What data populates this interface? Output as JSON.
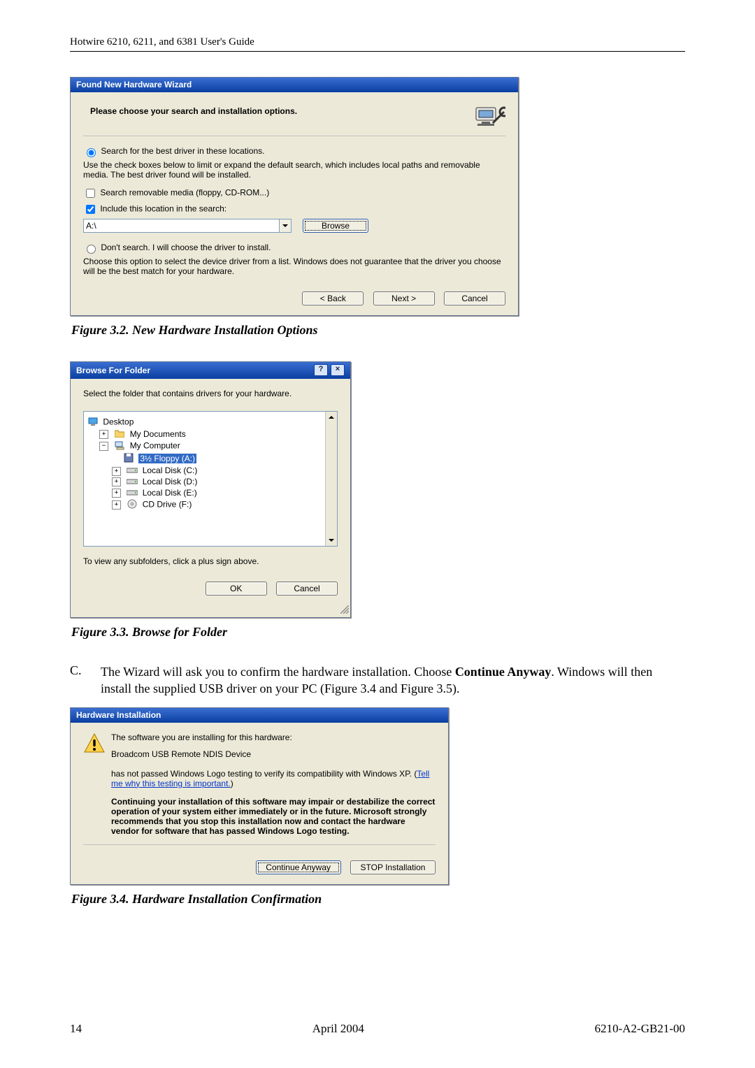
{
  "page": {
    "running_head": "Hotwire 6210, 6211, and 6381 User's Guide",
    "page_number": "14",
    "date": "April 2004",
    "doc_number": "6210-A2-GB21-00"
  },
  "fig32": {
    "caption": "Figure 3.2. New Hardware Installation Options"
  },
  "fig33": {
    "caption": "Figure 3.3. Browse for Folder"
  },
  "fig34": {
    "caption": "Figure 3.4. Hardware Installation Confirmation"
  },
  "stepC": {
    "marker": "C.",
    "text_before_bold": "The Wizard will ask you to confirm the hardware installation. Choose ",
    "bold": "Continue Anyway",
    "text_after_bold": ". Windows will then install the supplied USB driver on your PC (Figure 3.4 and Figure 3.5)."
  },
  "wiz": {
    "title": "Found New Hardware Wizard",
    "heading": "Please choose your search and installation options.",
    "opt_search": "Search for the best driver in these locations.",
    "opt_search_help": "Use the check boxes below to limit or expand the default search, which includes local paths and removable media. The best driver found will be installed.",
    "chk_removable": "Search removable media (floppy, CD-ROM...)",
    "chk_include": "Include this location in the search:",
    "path_value": "A:\\",
    "browse": "Browse",
    "opt_noSearch": "Don't search. I will choose the driver to install.",
    "opt_noSearch_help": "Choose this option to select the device driver from a list.  Windows does not guarantee that the driver you choose will be the best match for your hardware.",
    "back": "< Back",
    "next": "Next >",
    "cancel": "Cancel"
  },
  "bff": {
    "title": "Browse For Folder",
    "prompt": "Select the folder that contains drivers for your hardware.",
    "hint": "To view any subfolders, click a plus sign above.",
    "ok": "OK",
    "cancel": "Cancel",
    "nodes": {
      "desktop": "Desktop",
      "mydocs": "My Documents",
      "mycomp": "My Computer",
      "floppy": "3½ Floppy (A:)",
      "c": "Local Disk (C:)",
      "d": "Local Disk (D:)",
      "e": "Local Disk (E:)",
      "cd": "CD Drive (F:)"
    }
  },
  "hwi": {
    "title": "Hardware Installation",
    "line1": "The software you are installing for this hardware:",
    "device": "Broadcom USB Remote NDIS Device",
    "line2a": "has not passed Windows Logo testing to verify its compatibility with Windows XP. (",
    "link": "Tell me why this testing is important.",
    "line2b": ")",
    "bold_block": "Continuing your installation of this software may impair or destabilize the correct operation of your system either immediately or in the future. Microsoft strongly recommends that you stop this installation now and contact the hardware vendor for software that has passed Windows Logo testing.",
    "continue": "Continue Anyway",
    "stop": "STOP Installation"
  }
}
